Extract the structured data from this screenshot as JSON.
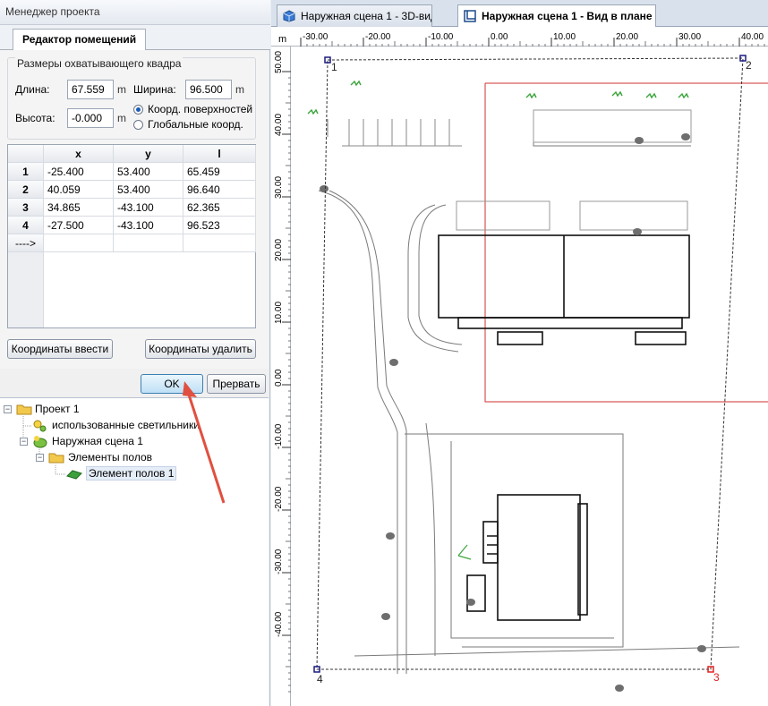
{
  "manager": {
    "title": "Менеджер проекта",
    "tab": "Редактор помещений"
  },
  "bbox_group": {
    "title": "Размеры охватывающего квадра",
    "length_label": "Длина:",
    "length_value": "67.559",
    "length_unit": "m",
    "width_label": "Ширина:",
    "width_value": "96.500",
    "width_unit": "m",
    "height_label": "Высота:",
    "height_value": "-0.000",
    "height_unit": "m",
    "radio_surface": "Коорд. поверхностей",
    "radio_global": "Глобальные коорд."
  },
  "grid": {
    "headers": [
      "x",
      "y",
      "l"
    ],
    "rows": [
      {
        "n": "1",
        "x": "-25.400",
        "y": "53.400",
        "l": "65.459"
      },
      {
        "n": "2",
        "x": "40.059",
        "y": "53.400",
        "l": "96.640"
      },
      {
        "n": "3",
        "x": "34.865",
        "y": "-43.100",
        "l": "62.365"
      },
      {
        "n": "4",
        "x": "-27.500",
        "y": "-43.100",
        "l": "96.523"
      }
    ],
    "new_row_marker": "---->"
  },
  "buttons": {
    "enter_coords": "Координаты ввести",
    "delete_coords": "Координаты удалить",
    "ok": "OK",
    "abort": "Прервать"
  },
  "tree": {
    "project": "Проект 1",
    "used_lights": "использованные светильники",
    "scene": "Наружная сцена 1",
    "floor_elements": "Элементы полов",
    "floor_element": "Элемент полов 1"
  },
  "doc_tabs": [
    {
      "label": "Наружная сцена 1 - 3D-вид",
      "active": false
    },
    {
      "label": "Наружная сцена 1 - Вид в плане",
      "active": true
    }
  ],
  "ruler": {
    "unit": "m",
    "top_ticks": [
      "-30.00",
      "-20.00",
      "-10.00",
      "0.00",
      "10.00",
      "20.00",
      "30.00",
      "40.00"
    ],
    "left_ticks": [
      "50.00",
      "40.00",
      "30.00",
      "20.00",
      "10.00",
      "0.00",
      "-10.00",
      "-20.00",
      "-30.00",
      "-40.00"
    ]
  },
  "plan": {
    "corner_labels": [
      "1",
      "2",
      "3",
      "4"
    ],
    "colors": {
      "selection": "#1a1a80",
      "active_corner": "#e02020",
      "area_outline": "#d03030",
      "arrow": "#e05040"
    }
  }
}
